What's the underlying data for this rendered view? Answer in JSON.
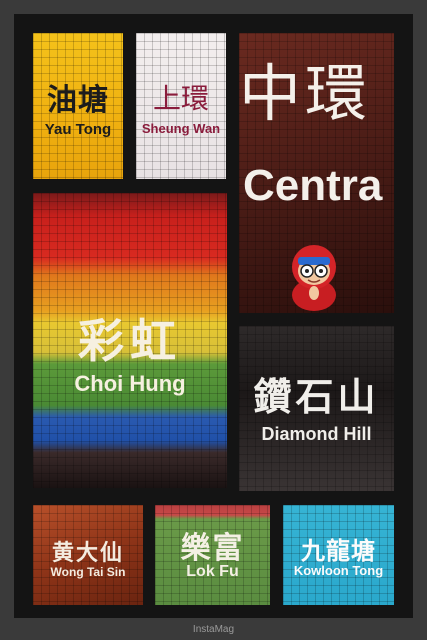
{
  "collage": {
    "tiles": {
      "yau_tong": {
        "chinese": "油塘",
        "english": "Yau Tong"
      },
      "sheung_wan": {
        "chinese": "上環",
        "english": "Sheung Wan"
      },
      "central": {
        "chinese": "中環",
        "english": "Centra"
      },
      "choi_hung": {
        "chinese": "彩虹",
        "english": "Choi Hung"
      },
      "diamond_hill": {
        "chinese": "鑽石山",
        "english": "Diamond Hill"
      },
      "wong_tai_sin": {
        "chinese": "黄大仙",
        "english": "Wong Tai Sin"
      },
      "lok_fu": {
        "chinese": "樂富",
        "english": "Lok Fu"
      },
      "kowloon_tong": {
        "chinese": "九龍塘",
        "english": "Kowloon Tong"
      }
    },
    "mascot_icon": "hooded-figurine-icon",
    "watermark": "InstaMag"
  }
}
